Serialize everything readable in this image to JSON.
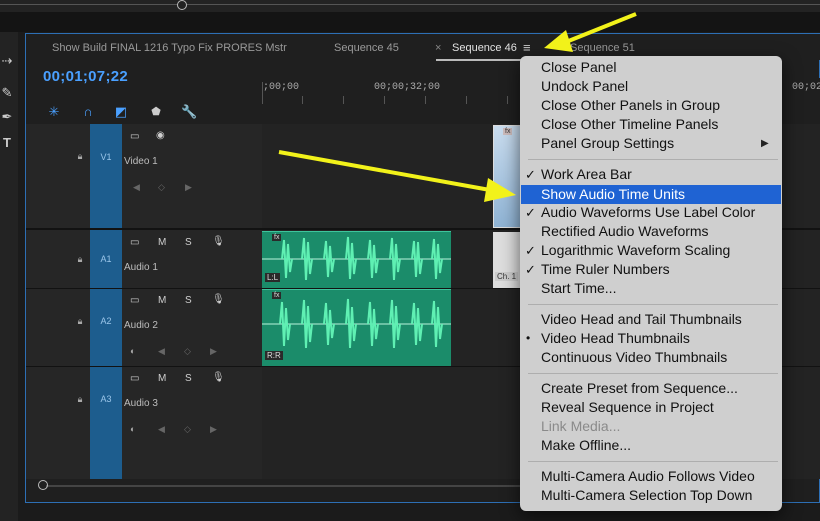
{
  "tabs": {
    "tab1": "Show Build FINAL 1216 Typo Fix PRORES Mstr",
    "tab2": "Sequence 45",
    "close_x": "×",
    "tab3": "Sequence 46",
    "menu_glyph": "≡",
    "tab4": "Sequence 51"
  },
  "timecode": "00;01;07;22",
  "ruler": {
    "start": ";00;00",
    "mid": "00;00;32;00",
    "end": "00;02"
  },
  "tracks": {
    "v1": {
      "target": "V1",
      "name": "Video 1"
    },
    "a1": {
      "target": "A1",
      "name": "Audio 1",
      "m": "M",
      "s": "S"
    },
    "a2": {
      "target": "A2",
      "name": "Audio 2",
      "m": "M",
      "s": "S"
    },
    "a3": {
      "target": "A3",
      "name": "Audio 3",
      "m": "M",
      "s": "S"
    }
  },
  "clips": {
    "a1_label": "L:L",
    "a2_label": "R:R",
    "fx": "fx",
    "video_ch": "Ch. 1"
  },
  "menu": {
    "close_panel": "Close Panel",
    "undock_panel": "Undock Panel",
    "close_other_group": "Close Other Panels in Group",
    "close_other_timeline": "Close Other Timeline Panels",
    "panel_group_settings": "Panel Group Settings",
    "submenu_arrow": "▶",
    "work_area_bar": "Work Area Bar",
    "show_audio_time_units": "Show Audio Time Units",
    "waveforms_label_color": "Audio Waveforms Use Label Color",
    "rectified_waveforms": "Rectified Audio Waveforms",
    "log_waveform": "Logarithmic Waveform Scaling",
    "time_ruler_numbers": "Time Ruler Numbers",
    "start_time": "Start Time...",
    "video_head_tail": "Video Head and Tail Thumbnails",
    "video_head": "Video Head Thumbnails",
    "continuous_video": "Continuous Video Thumbnails",
    "create_preset": "Create Preset from Sequence...",
    "reveal_sequence": "Reveal Sequence in Project",
    "link_media": "Link Media...",
    "make_offline": "Make Offline...",
    "multicam_audio": "Multi-Camera Audio Follows Video",
    "multicam_selection": "Multi-Camera Selection Top Down",
    "check": "✓",
    "bullet": "•"
  },
  "colors": {
    "accent": "#1f63d3",
    "timecode": "#4aa0ff",
    "audio_clip": "#1b8c6a",
    "track_target": "#1d5d8e",
    "arrow": "#f2f21a"
  }
}
